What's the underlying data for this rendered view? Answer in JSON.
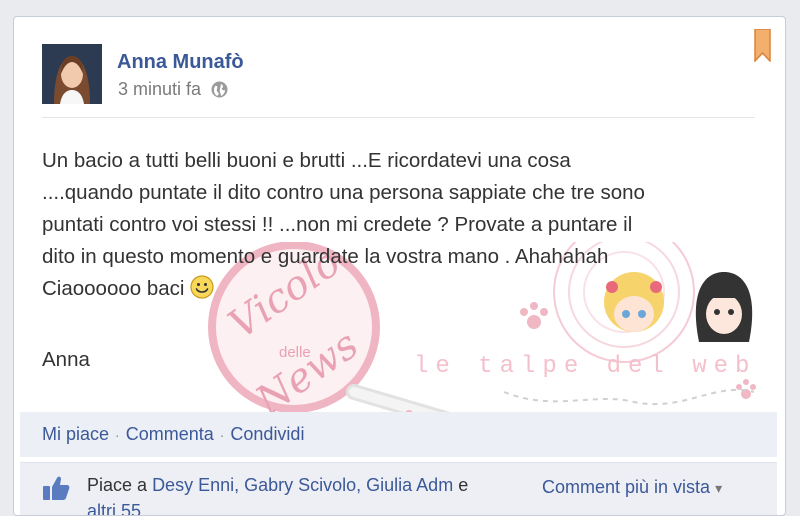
{
  "post": {
    "author": "Anna Munafò",
    "timestamp": "3 minuti fa",
    "audience_icon": "globe-icon",
    "text_lines": [
      "Un bacio a tutti belli buoni e brutti ...E ricordatevi una cosa",
      "....quando puntate il dito contro una persona sappiate che tre sono",
      "puntati contro voi stessi !! ...non mi credete ? Provate a puntare il",
      "dito in questo momento e guardate la vostra mano . Ahahahah",
      "Ciaoooooo baci"
    ],
    "signature": "Anna"
  },
  "actions": {
    "like": "Mi piace",
    "separator": "·",
    "comment": "Commenta",
    "share": "Condividi"
  },
  "likes": {
    "prefix": "Piace a",
    "names": "Desy Enni, Gabry Scivolo, Giulia Adm",
    "suffix": "e",
    "line2": "altri 55"
  },
  "comments_sort": {
    "label": "Comment più in vista",
    "arrow": "▾"
  },
  "watermark": {
    "logo_text_1": "Vicolo",
    "logo_text_2": "delle",
    "logo_text_3": "News",
    "banner_text": "le talpe del web"
  },
  "colors": {
    "link": "#3b5998",
    "text": "#333333",
    "muted": "#7a7a7a",
    "bookmark": "#f0a35a",
    "watermark": "#f2b8c6"
  }
}
